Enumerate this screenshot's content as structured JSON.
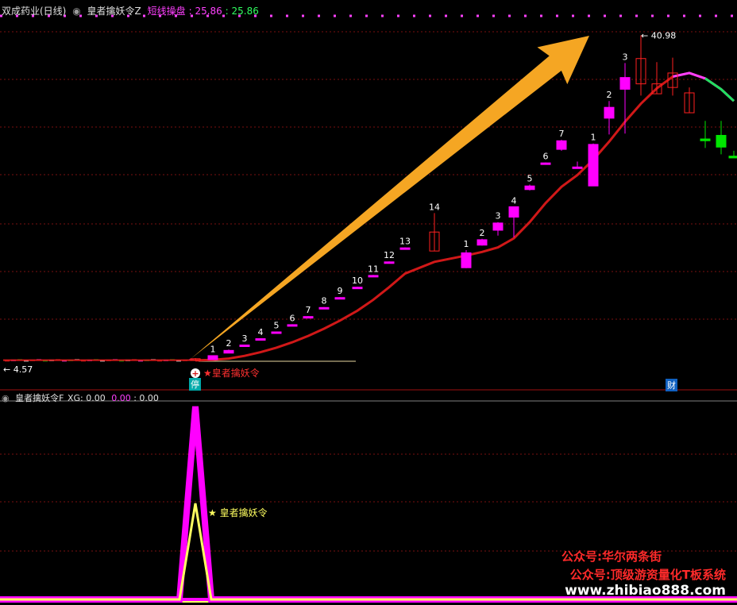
{
  "main_panel": {
    "stock": "双成药业(日线)",
    "indicator": "皇者擒妖令Z",
    "line_name": "短线操盘",
    "line_value_1": ": 25.86",
    "line_value_2": ": 25.86",
    "high_marker": "← 40.98",
    "low_marker": "← 4.57",
    "signal_text": "★皇者擒妖令",
    "limit_badge": "停",
    "finance_badge": "财"
  },
  "sub_panel": {
    "indicator": "皇者擒妖令F",
    "xg_label": "XG: 0.00",
    "value_2": "0.00",
    "value_3": ": 0.00",
    "signal_text": "★ 皇者擒妖令"
  },
  "watermarks": {
    "line1": "公众号:华尔两条街",
    "line2": "公众号:顶级游资量化T板系统",
    "line3": "www.zhibiao888.com"
  },
  "colors": {
    "up": "#ff00ff",
    "down": "#00e600",
    "hollow": "#ff2020",
    "ma": "#d01818",
    "arrow": "#f5a623",
    "grid": "#7a1010",
    "watermark": "#ff2a2a"
  },
  "chart_data": [
    {
      "type": "candlestick",
      "title": "皇者擒妖令Z",
      "ylim": [
        2,
        44
      ],
      "grid": true,
      "candles": [
        {
          "label": "",
          "o": 5.18,
          "h": 5.25,
          "l": 4.95,
          "c": 5.1
        },
        {
          "label": "1",
          "o": 5.08,
          "h": 5.55,
          "l": 5.05,
          "c": 5.52
        },
        {
          "label": "2",
          "o": 5.8,
          "h": 6.2,
          "l": 5.8,
          "c": 6.1
        },
        {
          "label": "3",
          "o": 6.6,
          "h": 6.75,
          "l": 6.55,
          "c": 6.7
        },
        {
          "label": "4",
          "o": 7.3,
          "h": 7.45,
          "l": 7.25,
          "c": 7.4
        },
        {
          "label": "5",
          "o": 8.1,
          "h": 8.2,
          "l": 8.05,
          "c": 8.15
        },
        {
          "label": "6",
          "o": 8.85,
          "h": 9.0,
          "l": 8.8,
          "c": 8.95
        },
        {
          "label": "7",
          "o": 9.8,
          "h": 9.9,
          "l": 9.75,
          "c": 9.85
        },
        {
          "label": "8",
          "o": 10.8,
          "h": 10.9,
          "l": 10.75,
          "c": 10.85
        },
        {
          "label": "9",
          "o": 11.9,
          "h": 12.0,
          "l": 11.85,
          "c": 11.95
        },
        {
          "label": "10",
          "o": 13.05,
          "h": 13.15,
          "l": 13.0,
          "c": 13.1
        },
        {
          "label": "11",
          "o": 14.35,
          "h": 14.45,
          "l": 14.3,
          "c": 14.4
        },
        {
          "label": "12",
          "o": 15.85,
          "h": 15.95,
          "l": 15.8,
          "c": 15.9
        },
        {
          "label": "13",
          "o": 17.4,
          "h": 17.5,
          "l": 17.35,
          "c": 17.45
        },
        {
          "label": "14",
          "o": 19.2,
          "h": 21.3,
          "l": 17.1,
          "c": 17.1
        },
        {
          "label": "1",
          "o": 15.25,
          "h": 17.2,
          "l": 15.2,
          "c": 16.9
        },
        {
          "label": "2",
          "o": 17.75,
          "h": 18.45,
          "l": 17.7,
          "c": 18.35
        },
        {
          "label": "3",
          "o": 19.4,
          "h": 20.3,
          "l": 18.8,
          "c": 20.2
        },
        {
          "label": "4",
          "o": 20.85,
          "h": 22.0,
          "l": 18.6,
          "c": 22.0
        },
        {
          "label": "5",
          "o": 23.9,
          "h": 24.45,
          "l": 23.8,
          "c": 24.3
        },
        {
          "label": "6",
          "o": 26.8,
          "h": 26.9,
          "l": 26.75,
          "c": 26.85
        },
        {
          "label": "7",
          "o": 28.35,
          "h": 29.4,
          "l": 28.2,
          "c": 29.3
        },
        {
          "label": "",
          "o": 26.4,
          "h": 27.0,
          "l": 26.3,
          "c": 26.4
        },
        {
          "label": "1",
          "o": 24.3,
          "h": 29.0,
          "l": 24.3,
          "c": 28.9
        },
        {
          "label": "2",
          "o": 31.8,
          "h": 33.7,
          "l": 30.0,
          "c": 33.0
        },
        {
          "label": "3",
          "o": 35.0,
          "h": 37.9,
          "l": 30.1,
          "c": 36.3
        },
        {
          "label": "",
          "o": 35.6,
          "h": 40.98,
          "l": 34.3,
          "c": 38.4
        },
        {
          "label": "",
          "o": 34.5,
          "h": 38.0,
          "l": 34.5,
          "c": 35.6
        },
        {
          "label": "",
          "o": 35.2,
          "h": 38.5,
          "l": 34.3,
          "c": 36.8
        },
        {
          "label": "",
          "o": 34.6,
          "h": 35.2,
          "l": 32.4,
          "c": 32.4
        },
        {
          "label": "",
          "o": 29.5,
          "h": 31.5,
          "l": 28.5,
          "c": 29.3
        },
        {
          "label": "",
          "o": 29.9,
          "h": 31.5,
          "l": 27.8,
          "c": 28.6
        },
        {
          "label": "",
          "o": 27.6,
          "h": 28.2,
          "l": 27.4,
          "c": 27.4
        }
      ],
      "ma_line": [
        5.0,
        5.05,
        5.2,
        5.5,
        5.9,
        6.4,
        7.0,
        7.7,
        8.5,
        9.4,
        10.5,
        11.7,
        13.1,
        14.6,
        15.9,
        16.6,
        17.0,
        17.5,
        18.5,
        20.3,
        22.4,
        24.2,
        25.5,
        27.2,
        29.2,
        31.4,
        33.4,
        35.1,
        36.4,
        36.8,
        36.2,
        35.0,
        33.7
      ],
      "high_value": 40.98,
      "low_value": 4.57
    },
    {
      "type": "line",
      "title": "皇者擒妖令F",
      "series": [
        {
          "name": "XG",
          "values": [
            0,
            0,
            1,
            0,
            0
          ]
        }
      ]
    }
  ]
}
